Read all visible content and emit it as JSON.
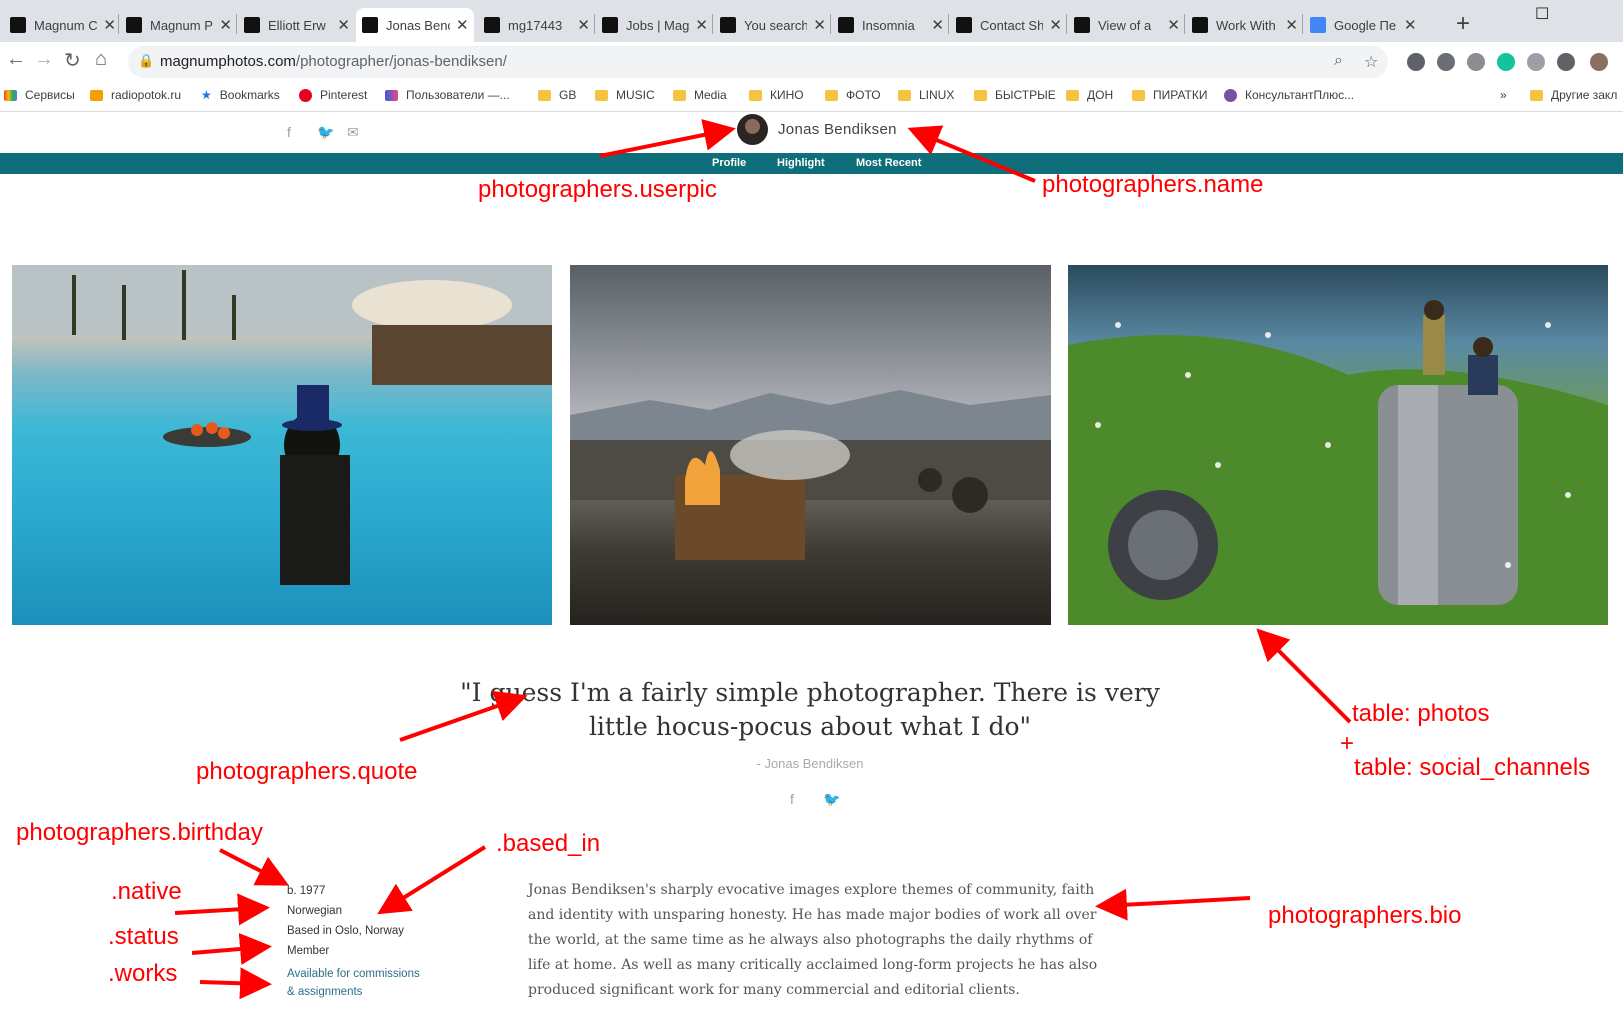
{
  "browser": {
    "tabs": [
      {
        "title": "Magnum C",
        "active": false
      },
      {
        "title": "Magnum P",
        "active": false
      },
      {
        "title": "Elliott Erw",
        "active": false
      },
      {
        "title": "Jonas Benc",
        "active": true
      },
      {
        "title": "mg17443",
        "active": false
      },
      {
        "title": "Jobs | Mag",
        "active": false
      },
      {
        "title": "You search",
        "active": false
      },
      {
        "title": "Insomnia",
        "active": false
      },
      {
        "title": "Contact Sh",
        "active": false
      },
      {
        "title": "View of a",
        "active": false
      },
      {
        "title": "Work With",
        "active": false
      },
      {
        "title": "Google Пе",
        "active": false
      }
    ],
    "url_domain": "magnumphotos.com",
    "url_path": "/photographer/jonas-bendiksen/",
    "bookmarks": [
      "Сервисы",
      "radiopotok.ru",
      "Bookmarks",
      "Pinterest",
      "Пользователи —...",
      "GB",
      "MUSIC",
      "Media",
      "КИНО",
      "ФОТО",
      "LINUX",
      "БЫСТРЫЕ",
      "ДОН",
      "ПИРАТКИ",
      "КонсультантПлюс...",
      "Другие закл"
    ]
  },
  "page": {
    "photographer_name": "Jonas Bendiksen",
    "nav": [
      "Profile",
      "Highlight",
      "Most Recent"
    ],
    "quote": "\"I guess I'm a fairly simple photographer. There is very little hocus-pocus about what I do\"",
    "quote_attribution": "- Jonas Bendiksen",
    "birth": "b. 1977",
    "native": "Norwegian",
    "based_in": "Based in Oslo, Norway",
    "status": "Member",
    "works_line1": "Available for commissions",
    "works_line2": "& assignments",
    "bio": "Jonas Bendiksen's sharply evocative images explore themes of community, faith and identity with unsparing honesty. He has made major bodies of work all over the world, at the same time as he always also photographs the daily rhythms of life at home. As well as many critically acclaimed long-form projects he has also produced significant work for many commercial and editorial clients."
  },
  "annotations": {
    "userpic": "photographers.userpic",
    "name": "photographers.name",
    "photos": "table: photos",
    "plus": "+",
    "social": "table: social_channels",
    "quote": "photographers.quote",
    "birthday": "photographers.birthday",
    "based_in": ".based_in",
    "native": ".native",
    "status": ".status",
    "works": ".works",
    "bio": "photographers.bio"
  },
  "colors": {
    "accent": "#0e6f7a",
    "annotation": "#ff0000"
  }
}
